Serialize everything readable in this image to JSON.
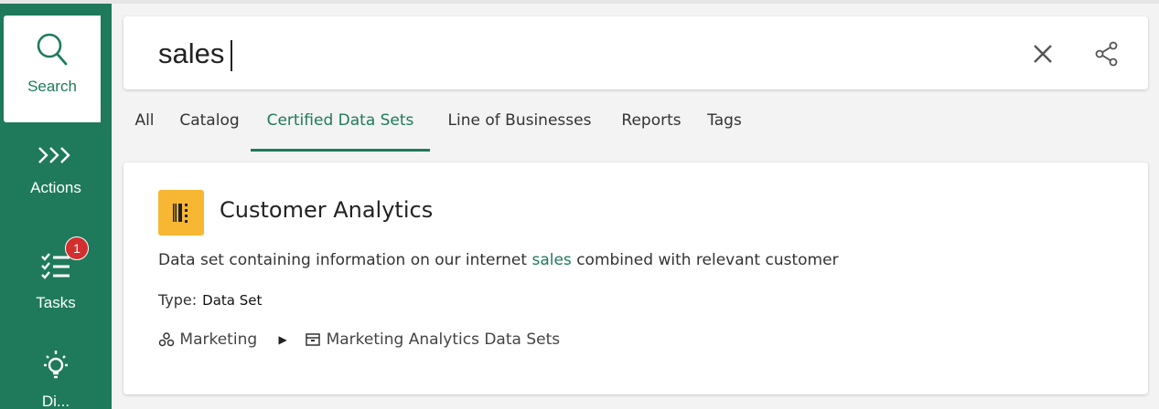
{
  "sidebar": {
    "items": [
      {
        "label": "Search",
        "icon": "search-icon",
        "active": true
      },
      {
        "label": "Actions",
        "icon": "chevrons-right-icon"
      },
      {
        "label": "Tasks",
        "icon": "task-list-icon",
        "badge": "1"
      },
      {
        "label": "Di...",
        "icon": "lightbulb-icon"
      }
    ]
  },
  "search": {
    "value": "sales",
    "placeholder": ""
  },
  "tabs": [
    {
      "label": "All"
    },
    {
      "label": "Catalog"
    },
    {
      "label": "Certified Data Sets",
      "active": true
    },
    {
      "label": "Line of Businesses"
    },
    {
      "label": "Reports"
    },
    {
      "label": "Tags"
    }
  ],
  "result": {
    "title": "Customer Analytics",
    "icon": "data-set-icon",
    "description_before": "Data set containing information on our internet ",
    "description_highlight": "sales",
    "description_after": " combined with relevant customer",
    "type_label": "Type:",
    "type_value": "Data Set",
    "path": [
      {
        "label": "Marketing",
        "icon": "community-icon"
      },
      {
        "label": "Marketing Analytics Data Sets",
        "icon": "domain-icon"
      }
    ]
  },
  "colors": {
    "brand": "#1e7a5b",
    "badge": "#d32f2f",
    "dataset_icon_bg": "#f7b733"
  }
}
